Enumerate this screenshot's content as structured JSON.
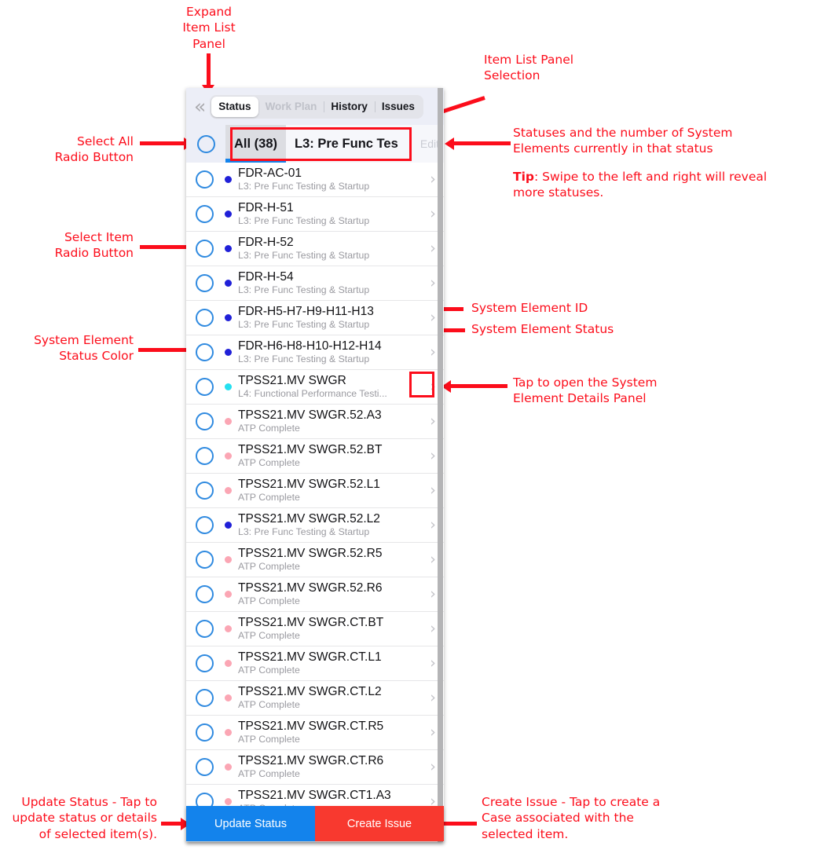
{
  "panel": {
    "collapse_icon": "chevron-double-left",
    "tabs": [
      {
        "label": "Status",
        "state": "active"
      },
      {
        "label": "Work Plan",
        "state": "disabled"
      },
      {
        "label": "History",
        "state": "normal"
      },
      {
        "label": "Issues",
        "state": "normal"
      }
    ],
    "edit_label": "Edit",
    "status_filters": [
      {
        "label": "All (38)",
        "active": true
      },
      {
        "label": "L3: Pre Func Tes",
        "active": false
      }
    ],
    "colors": {
      "accent_blue": "#1383ec",
      "issue_red": "#f8392f",
      "radio_blue": "#2f8ae0",
      "status_blue": "#2020d8",
      "status_cyan": "#25e0f0",
      "status_pink": "#fba6b4",
      "annotation_red": "#fc0d1b"
    },
    "items": [
      {
        "id": "FDR-AC-01",
        "status": "L3: Pre Func Testing & Startup",
        "dot": "#2020d8"
      },
      {
        "id": "FDR-H-51",
        "status": "L3: Pre Func Testing & Startup",
        "dot": "#2020d8"
      },
      {
        "id": "FDR-H-52",
        "status": "L3: Pre Func Testing & Startup",
        "dot": "#2020d8"
      },
      {
        "id": "FDR-H-54",
        "status": "L3: Pre Func Testing & Startup",
        "dot": "#2020d8"
      },
      {
        "id": "FDR-H5-H7-H9-H11-H13",
        "status": "L3: Pre Func Testing & Startup",
        "dot": "#2020d8"
      },
      {
        "id": "FDR-H6-H8-H10-H12-H14",
        "status": "L3: Pre Func Testing & Startup",
        "dot": "#2020d8"
      },
      {
        "id": "TPSS21.MV SWGR",
        "status": "L4: Functional Performance Testi...",
        "dot": "#25e0f0"
      },
      {
        "id": "TPSS21.MV SWGR.52.A3",
        "status": "ATP Complete",
        "dot": "#fba6b4"
      },
      {
        "id": "TPSS21.MV SWGR.52.BT",
        "status": "ATP Complete",
        "dot": "#fba6b4"
      },
      {
        "id": "TPSS21.MV SWGR.52.L1",
        "status": "ATP Complete",
        "dot": "#fba6b4"
      },
      {
        "id": "TPSS21.MV SWGR.52.L2",
        "status": "L3: Pre Func Testing & Startup",
        "dot": "#2020d8"
      },
      {
        "id": "TPSS21.MV SWGR.52.R5",
        "status": "ATP Complete",
        "dot": "#fba6b4"
      },
      {
        "id": "TPSS21.MV SWGR.52.R6",
        "status": "ATP Complete",
        "dot": "#fba6b4"
      },
      {
        "id": "TPSS21.MV SWGR.CT.BT",
        "status": "ATP Complete",
        "dot": "#fba6b4"
      },
      {
        "id": "TPSS21.MV SWGR.CT.L1",
        "status": "ATP Complete",
        "dot": "#fba6b4"
      },
      {
        "id": "TPSS21.MV SWGR.CT.L2",
        "status": "ATP Complete",
        "dot": "#fba6b4"
      },
      {
        "id": "TPSS21.MV SWGR.CT.R5",
        "status": "ATP Complete",
        "dot": "#fba6b4"
      },
      {
        "id": "TPSS21.MV SWGR.CT.R6",
        "status": "ATP Complete",
        "dot": "#fba6b4"
      },
      {
        "id": "TPSS21.MV SWGR.CT1.A3",
        "status": "ATP Complete",
        "dot": "#fba6b4"
      }
    ],
    "actions": {
      "update_status": "Update Status",
      "create_issue": "Create Issue"
    }
  },
  "annotations": {
    "expand_panel": "Expand\nItem List\nPanel",
    "select_all": "Select All\nRadio Button",
    "select_item": "Select Item\nRadio Button",
    "status_color": "System Element\nStatus Color",
    "panel_selection": "Item List Panel\nSelection",
    "statuses_count": "Statuses and the number of System\nElements currently in that status",
    "tip_bold": "Tip",
    "tip_rest": ": Swipe to the left and right will reveal\nmore statuses.",
    "element_id": "System Element ID",
    "element_status": "System Element Status",
    "tap_details": "Tap to open the System\nElement Details Panel",
    "update_status": "Update Status - Tap to\nupdate status or details\nof selected item(s).",
    "create_issue": "Create Issue - Tap to create a\nCase associated with the\nselected item."
  }
}
